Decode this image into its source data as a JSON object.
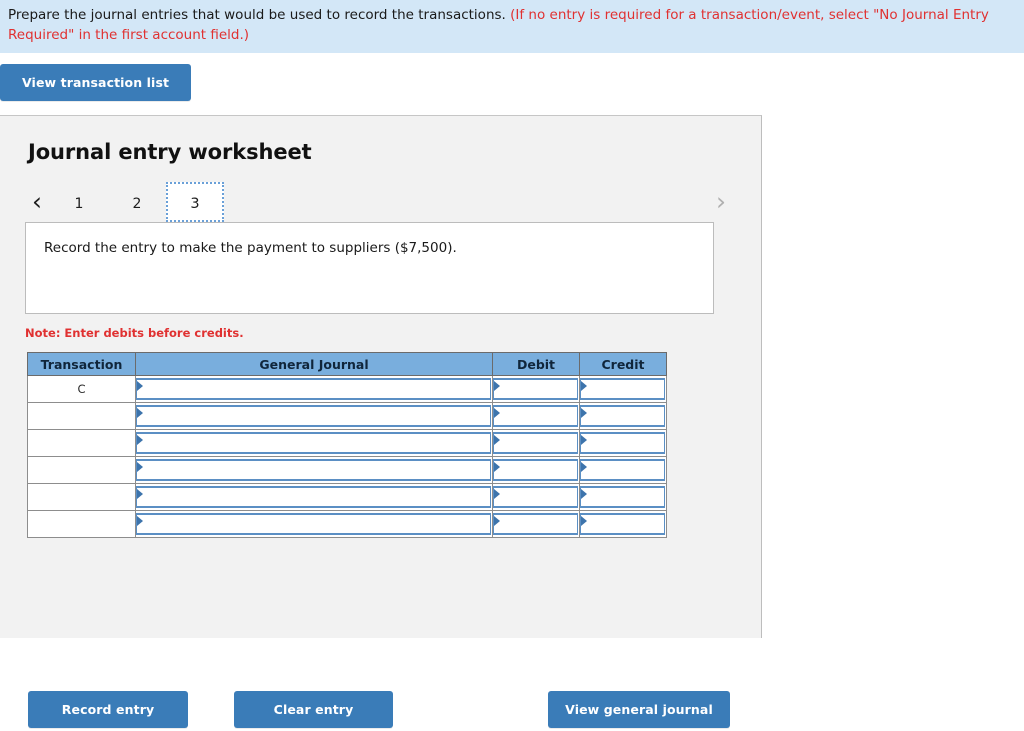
{
  "instruction": {
    "lead": "Prepare the journal entries that would be used to record the transactions. ",
    "hint": "(If no entry is required for a transaction/event, select \"No Journal Entry Required\" in the first account field.)"
  },
  "toolbar": {
    "view_transaction_list_label": "View transaction list"
  },
  "worksheet": {
    "title": "Journal entry worksheet",
    "pager": {
      "prev_icon": "‹",
      "next_icon": "›",
      "tabs": [
        {
          "label": "1",
          "active": false
        },
        {
          "label": "2",
          "active": false
        },
        {
          "label": "3",
          "active": true
        }
      ],
      "active_tab": "3"
    },
    "scenario_text": "Record the entry to make the payment to suppliers ($7,500).",
    "note": "Note: Enter debits before credits.",
    "table": {
      "headers": [
        "Transaction",
        "General Journal",
        "Debit",
        "Credit"
      ],
      "rows": [
        {
          "transaction": "C",
          "general_journal": "",
          "debit": "",
          "credit": ""
        },
        {
          "transaction": "",
          "general_journal": "",
          "debit": "",
          "credit": ""
        },
        {
          "transaction": "",
          "general_journal": "",
          "debit": "",
          "credit": ""
        },
        {
          "transaction": "",
          "general_journal": "",
          "debit": "",
          "credit": ""
        },
        {
          "transaction": "",
          "general_journal": "",
          "debit": "",
          "credit": ""
        },
        {
          "transaction": "",
          "general_journal": "",
          "debit": "",
          "credit": ""
        }
      ]
    },
    "actions": {
      "record_entry_label": "Record entry",
      "clear_entry_label": "Clear entry",
      "view_general_journal_label": "View general journal"
    }
  },
  "colors": {
    "banner_bg": "#d3e7f7",
    "hint_red": "#e03131",
    "button_blue": "#3a7cb8",
    "table_header_blue": "#79aedd",
    "panel_bg": "#f2f2f2",
    "input_border_blue": "#5b8fc4"
  }
}
